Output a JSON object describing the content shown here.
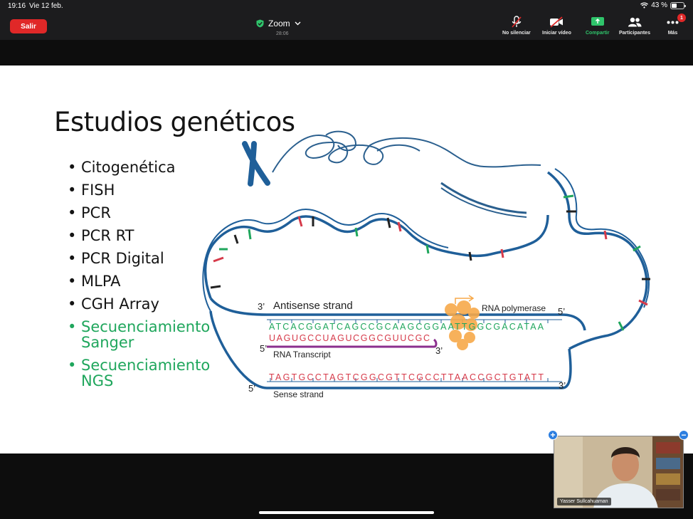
{
  "status": {
    "time": "19:16",
    "date": "Vie 12 feb.",
    "battery": "43 %",
    "battery_level": 0.43
  },
  "toolbar": {
    "leave_label": "Salir",
    "app_title": "Zoom",
    "timer": "28:06",
    "items": [
      {
        "label": "No silenciar",
        "icon": "muted-mic-icon"
      },
      {
        "label": "Iniciar vídeo",
        "icon": "video-off-icon"
      },
      {
        "label": "Compartir",
        "icon": "share-screen-icon"
      },
      {
        "label": "Participantes",
        "icon": "participants-icon"
      },
      {
        "label": "Más",
        "icon": "more-icon",
        "badge": "1"
      }
    ],
    "colors": {
      "leave": "#e02828",
      "share": "#2fc46b"
    }
  },
  "slide": {
    "title": "Estudios genéticos",
    "bullets": [
      "Citogenética",
      "FISH",
      "PCR",
      "PCR RT",
      "PCR Digital",
      "MLPA",
      "CGH Array",
      "Secuenciamiento Sanger",
      "Secuenciamiento NGS"
    ],
    "diagram": {
      "antisense_label": "Antisense strand",
      "sense_label": "Sense strand",
      "rna_label": "RNA Transcript",
      "polymerase_label": "RNA polymerase",
      "three_prime": "3’",
      "five_prime": "5’",
      "antisense_seq": "ATCACGGATCAGCCGCAAGCGGAATTGGCGACATAA",
      "rna_seq": "UAGUGCCUAGUCGGCGUUCGC",
      "sense_seq": "TAGTGCCTAGTCGGCGTTCGCCTTAACCGCTGTATT"
    },
    "colors": {
      "highlight": "#1fa65c",
      "dna": "#1f5f99"
    }
  },
  "video": {
    "participant_name": "Yasser Sullcahuaman"
  }
}
